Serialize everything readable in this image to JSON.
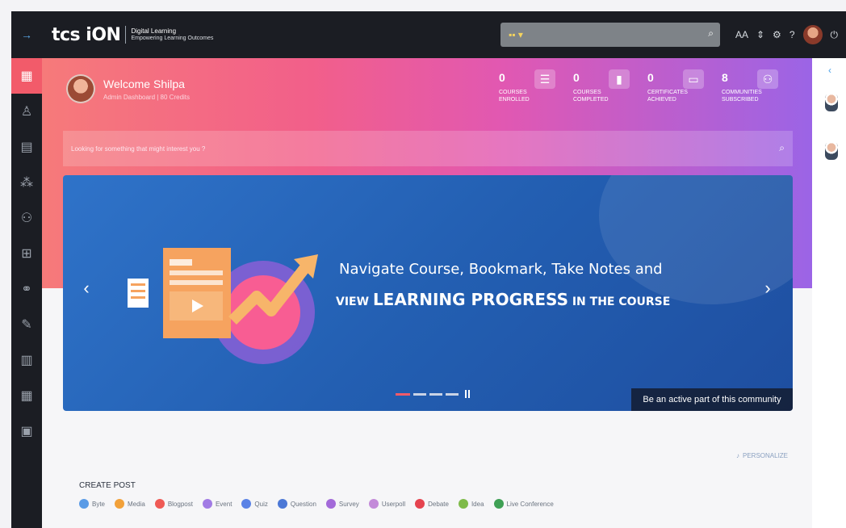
{
  "topbar": {
    "menu_icon": "arrow-right-icon",
    "logo_main": "tcs iON",
    "logo_sub_title": "Digital Learning",
    "logo_sub_tagline": "Empowering Learning Outcomes",
    "search_apps_icon": "apps-grid-icon",
    "search_icon": "search-icon",
    "icons": [
      "font-size-icon",
      "settings-icon",
      "gear-icon",
      "help-icon",
      "avatar",
      "power-icon"
    ],
    "help_label": "?"
  },
  "sidebar": {
    "items": [
      {
        "name": "dashboard",
        "icon": "grid-icon",
        "active": true
      },
      {
        "name": "profile",
        "icon": "user-icon"
      },
      {
        "name": "courses",
        "icon": "book-icon"
      },
      {
        "name": "networks",
        "icon": "network-icon"
      },
      {
        "name": "communities",
        "icon": "group-icon"
      },
      {
        "name": "catalog",
        "icon": "catalog-icon"
      },
      {
        "name": "connections",
        "icon": "connections-icon"
      },
      {
        "name": "assessments",
        "icon": "edit-icon"
      },
      {
        "name": "documents",
        "icon": "document-icon"
      },
      {
        "name": "calendar",
        "icon": "calendar-icon"
      },
      {
        "name": "reports",
        "icon": "report-icon"
      }
    ]
  },
  "welcome": {
    "title": "Welcome Shilpa",
    "subtitle": "Admin Dashboard | 80 Credits"
  },
  "stats": [
    {
      "value": "0",
      "label_line1": "COURSES",
      "label_line2": "ENROLLED",
      "icon": "courses-enrolled-icon"
    },
    {
      "value": "0",
      "label_line1": "COURSES",
      "label_line2": "COMPLETED",
      "icon": "courses-completed-icon"
    },
    {
      "value": "0",
      "label_line1": "CERTIFICATES",
      "label_line2": "ACHIEVED",
      "icon": "certificate-icon"
    },
    {
      "value": "8",
      "label_line1": "COMMUNITIES",
      "label_line2": "SUBSCRIBED",
      "icon": "communities-icon"
    }
  ],
  "interest_search": {
    "placeholder": "Looking for something that might interest you ?",
    "icon": "search-icon"
  },
  "banner": {
    "headline": "Navigate Course, Bookmark, Take Notes and",
    "subhead_prefix": "VIEW ",
    "subhead_main": "LEARNING PROGRESS",
    "subhead_suffix": " IN THE COURSE",
    "caption": "Be an active part of this community",
    "prev_icon": "chevron-left-icon",
    "next_icon": "chevron-right-icon",
    "slides_total": 4,
    "slide_active_index": 0
  },
  "personalize": {
    "label": "PERSONALIZE",
    "icon": "personalize-icon"
  },
  "create_post": {
    "title": "CREATE POST",
    "types": [
      {
        "label": "Byte",
        "color": "#5a9be6"
      },
      {
        "label": "Media",
        "color": "#f2a13a"
      },
      {
        "label": "Blogpost",
        "color": "#ef5a55"
      },
      {
        "label": "Event",
        "color": "#a17be4"
      },
      {
        "label": "Quiz",
        "color": "#5b83e6"
      },
      {
        "label": "Question",
        "color": "#4c78d6"
      },
      {
        "label": "Survey",
        "color": "#a36ad9"
      },
      {
        "label": "Userpoll",
        "color": "#c38ad9"
      },
      {
        "label": "Debate",
        "color": "#e5434f"
      },
      {
        "label": "Idea",
        "color": "#7fbb4a"
      },
      {
        "label": "Live Conference",
        "color": "#3fa055"
      }
    ]
  },
  "rightrail": {
    "collapse_icon": "chevron-left-icon",
    "avatars": [
      "contact-avatar-1",
      "contact-avatar-2"
    ]
  }
}
